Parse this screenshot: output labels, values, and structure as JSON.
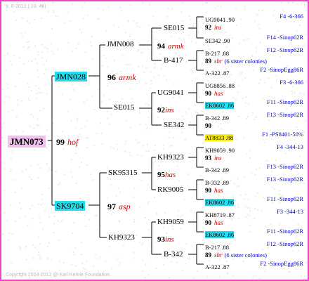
{
  "header": {
    "date": "9. 6-2012 ( 23. 46)"
  },
  "footer": {
    "copyright": "Copyright 2004-2012 @ Karl Kehrle Foundation."
  },
  "gen1": {
    "name": "JMN073",
    "gen": "99",
    "breed": "hof"
  },
  "gen2": [
    {
      "name": "JMN028",
      "gen": "96",
      "breed": "armk"
    },
    {
      "name": "SK9704",
      "gen": "97",
      "breed": "asp"
    }
  ],
  "gen3": [
    {
      "name": "JMN008",
      "gen": "94",
      "breed": "armk"
    },
    {
      "name": "SE015",
      "gen": "92",
      "breed": "ins"
    },
    {
      "name": "SK95315",
      "gen": "95",
      "breed": "has"
    },
    {
      "name": "KH9323",
      "gen": "93",
      "breed": "ins"
    }
  ],
  "gen4": [
    {
      "name": "SE015",
      "gen": "",
      "breed": ""
    },
    {
      "name": "B-417",
      "gen": "",
      "breed": ""
    },
    {
      "name": "UG9041",
      "gen": "",
      "breed": ""
    },
    {
      "name": "SE342",
      "gen": "",
      "breed": ""
    },
    {
      "name": "KH9323",
      "gen": "",
      "breed": ""
    },
    {
      "name": "RK9005",
      "gen": "",
      "breed": ""
    },
    {
      "name": "KH9059",
      "gen": "",
      "breed": ""
    },
    {
      "name": "B-342",
      "gen": "",
      "breed": ""
    }
  ],
  "gen5": [
    {
      "name": "UG9041 .90",
      "gen": "92",
      "breed": "ins",
      "right": "F4 -6-366"
    },
    {
      "name": "SE342 .90",
      "gen": "",
      "breed": "",
      "right": "F14 -Sinop62R"
    },
    {
      "name": "B-217 .88",
      "gen": "89",
      "breed": "shr",
      "right": "F12 -Sinop62R",
      "note": "(6 sister colonies)"
    },
    {
      "name": "A-322 .87",
      "gen": "",
      "breed": "",
      "right": "F2 -SinopEgg86R"
    },
    {
      "name": "UG8856 .88",
      "gen": "90",
      "breed": "has",
      "right": "F3 -6-366"
    },
    {
      "name": "EK8602 .86",
      "gen": "",
      "breed": "",
      "right": "F11 -Sinop62R"
    },
    {
      "name": "B-342 .89",
      "gen": "90",
      "breed": "",
      "right": "F13 -Sinop62R"
    },
    {
      "name": "AT8833 .88",
      "gen": "",
      "breed": "",
      "right": "F1 -PS8401-50%"
    },
    {
      "name": "KH9059 .90",
      "gen": "93",
      "breed": "ins",
      "right": "F4 -344-13"
    },
    {
      "name": "B-342 .89",
      "gen": "",
      "breed": "",
      "right": "F13 -Sinop62R"
    },
    {
      "name": "B-332 .89",
      "gen": "90",
      "breed": "has",
      "right": "F13 -Sinop62R"
    },
    {
      "name": "EK8602 .86",
      "gen": "",
      "breed": "",
      "right": "F11 -Sinop62R"
    },
    {
      "name": "KH8719 .87",
      "gen": "90",
      "breed": "has",
      "right": "F3 -344-13"
    },
    {
      "name": "EK8602 .86",
      "gen": "",
      "breed": "",
      "right": "F11 -Sinop62R"
    },
    {
      "name": "B-217 .88",
      "gen": "89",
      "breed": "shr",
      "right": "F12 -Sinop62R",
      "note": "(6 sister colonies)"
    },
    {
      "name": "A-322 .87",
      "gen": "",
      "breed": "",
      "right": "F2 -SinopEgg86R"
    }
  ]
}
